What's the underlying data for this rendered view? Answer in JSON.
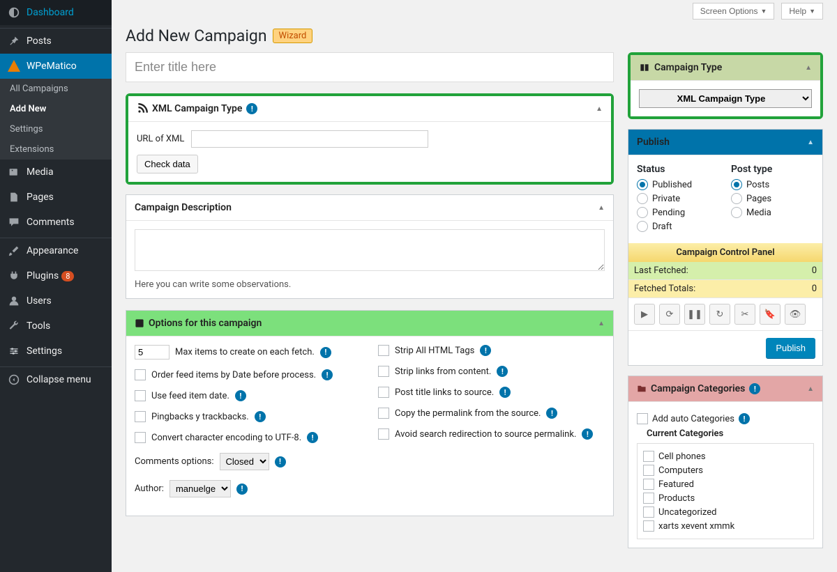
{
  "screen": {
    "options": "Screen Options",
    "help": "Help"
  },
  "page": {
    "title": "Add New Campaign",
    "wizard": "Wizard",
    "title_placeholder": "Enter title here"
  },
  "sidebar": {
    "dashboard": "Dashboard",
    "posts": "Posts",
    "wpematico": "WPeMatico",
    "subs": {
      "all": "All Campaigns",
      "add": "Add New",
      "settings": "Settings",
      "extensions": "Extensions"
    },
    "media": "Media",
    "pages": "Pages",
    "comments": "Comments",
    "appearance": "Appearance",
    "plugins": "Plugins",
    "plugins_count": "8",
    "users": "Users",
    "tools": "Tools",
    "settings": "Settings",
    "collapse": "Collapse menu"
  },
  "xml_panel": {
    "title": "XML Campaign Type",
    "url_label": "URL of XML",
    "check_btn": "Check data"
  },
  "desc_panel": {
    "title": "Campaign Description",
    "note": "Here you can write some observations."
  },
  "options_panel": {
    "title": "Options for this campaign",
    "max_items_value": "5",
    "max_items": "Max items to create on each fetch.",
    "order_date": "Order feed items by Date before process.",
    "use_date": "Use feed item date.",
    "pingbacks": "Pingbacks y trackbacks.",
    "utf8": "Convert character encoding to UTF-8.",
    "comments_label": "Comments options:",
    "comments_value": "Closed",
    "author_label": "Author:",
    "author_value": "manuelge",
    "strip_html": "Strip All HTML Tags",
    "strip_links": "Strip links from content.",
    "title_link": "Post title links to source.",
    "copy_permalink": "Copy the permalink from the source.",
    "avoid_redirect": "Avoid search redirection to source permalink."
  },
  "type_panel": {
    "title": "Campaign Type",
    "selected": "XML Campaign Type"
  },
  "publish_panel": {
    "title": "Publish",
    "status": "Status",
    "s_published": "Published",
    "s_private": "Private",
    "s_pending": "Pending",
    "s_draft": "Draft",
    "posttype": "Post type",
    "pt_posts": "Posts",
    "pt_pages": "Pages",
    "pt_media": "Media",
    "ccp_title": "Campaign Control Panel",
    "last_fetched": "Last Fetched:",
    "last_fetched_val": "0",
    "fetched_totals": "Fetched Totals:",
    "fetched_totals_val": "0",
    "publish_btn": "Publish"
  },
  "cat_panel": {
    "title": "Campaign Categories",
    "add_auto": "Add auto Categories",
    "current": "Current Categories",
    "cats": [
      "Cell phones",
      "Computers",
      "Featured",
      "Products",
      "Uncategorized",
      "xarts xevent xmmk"
    ]
  }
}
